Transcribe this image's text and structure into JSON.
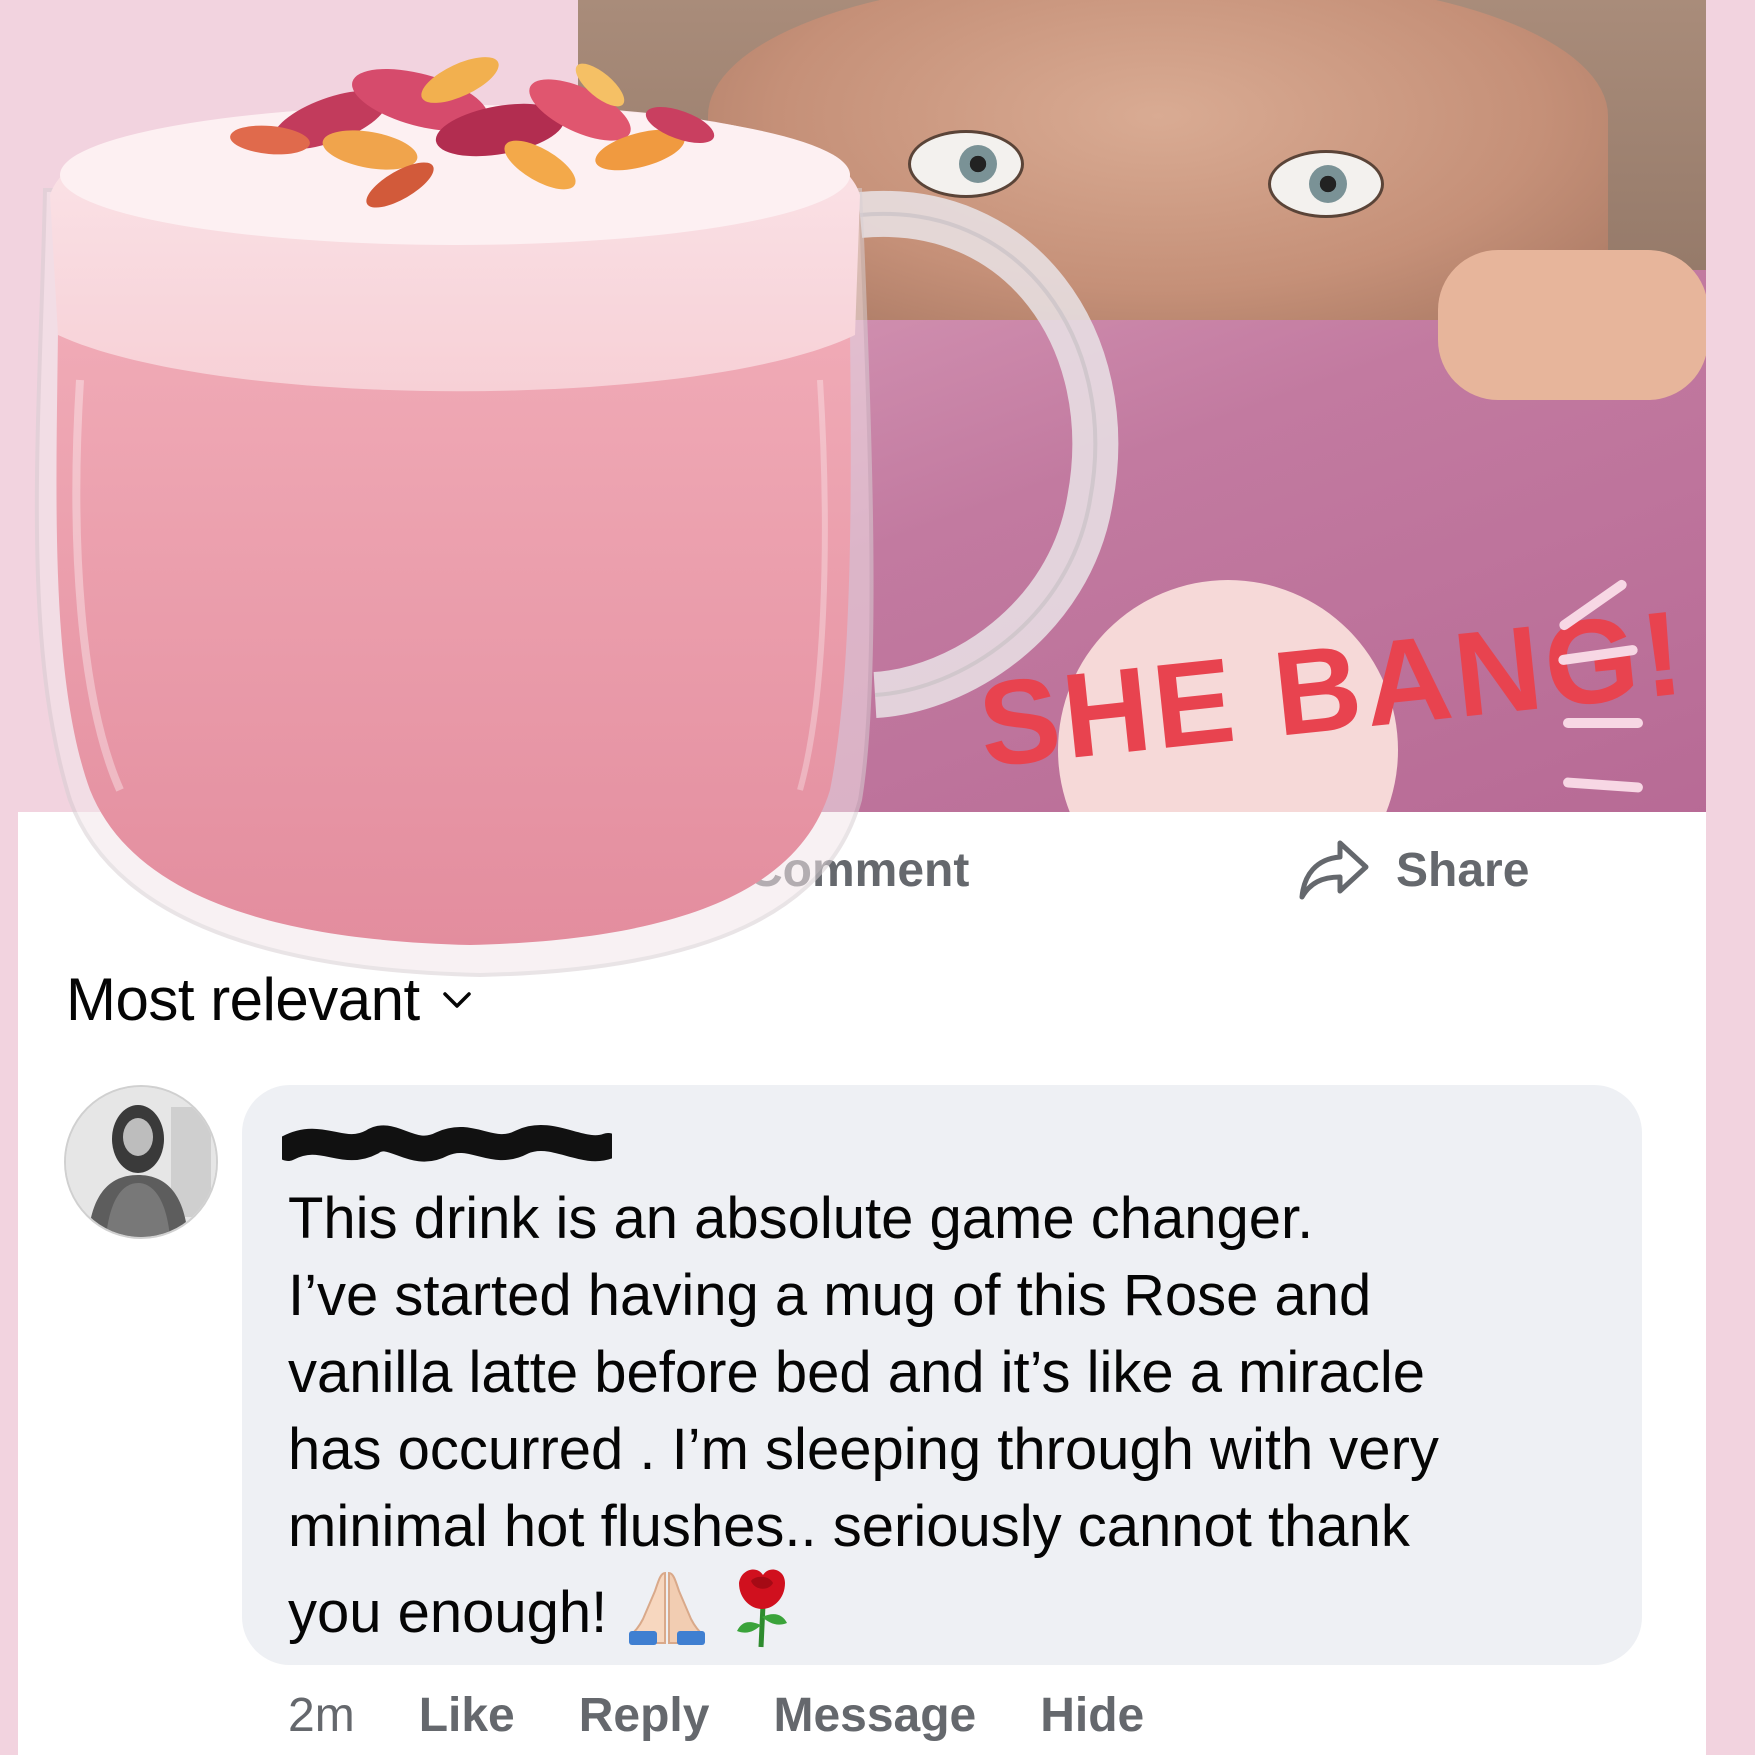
{
  "photo": {
    "brand_text": "SHE BANG!"
  },
  "actions": {
    "comment_label": "Comment",
    "share_label": "Share"
  },
  "sort": {
    "label": "Most relevant"
  },
  "comment": {
    "lines": [
      "This drink is an absolute game changer.",
      "I’ve started having a mug of this Rose and",
      "vanilla latte before bed and it’s like a miracle",
      "has occurred . I’m sleeping through with very",
      "minimal hot flushes.. seriously cannot thank",
      "you enough!"
    ],
    "emojis": [
      "folded-hands-icon",
      "rose-icon"
    ],
    "time": "2m",
    "like_label": "Like",
    "reply_label": "Reply",
    "message_label": "Message",
    "hide_label": "Hide"
  },
  "colors": {
    "page_background": "#f2d3df",
    "card": "#ffffff",
    "bubble": "#eef0f4",
    "secondary_text": "#65686d",
    "primary_text": "#050505",
    "latte_pink": "#e79aa8"
  }
}
